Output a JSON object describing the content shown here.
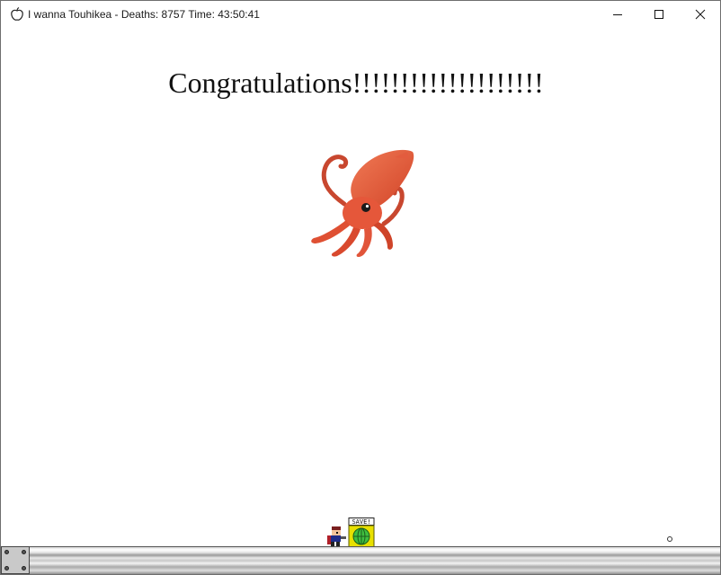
{
  "window": {
    "title": "I wanna Touhikea - Deaths: 8757 Time: 43:50:41",
    "app_icon": "apple-icon",
    "controls": [
      "minimize-icon",
      "maximize-icon",
      "close-icon"
    ]
  },
  "game": {
    "message": "Congratulations!!!!!!!!!!!!!!!!!!!!",
    "sprites": [
      "squid-icon",
      "player-sprite",
      "save-point"
    ],
    "save_label": "SAVE!"
  },
  "colors": {
    "squid": "#e8563a",
    "save_point": "#e8e000",
    "save_globe": "#3fbf3f"
  }
}
